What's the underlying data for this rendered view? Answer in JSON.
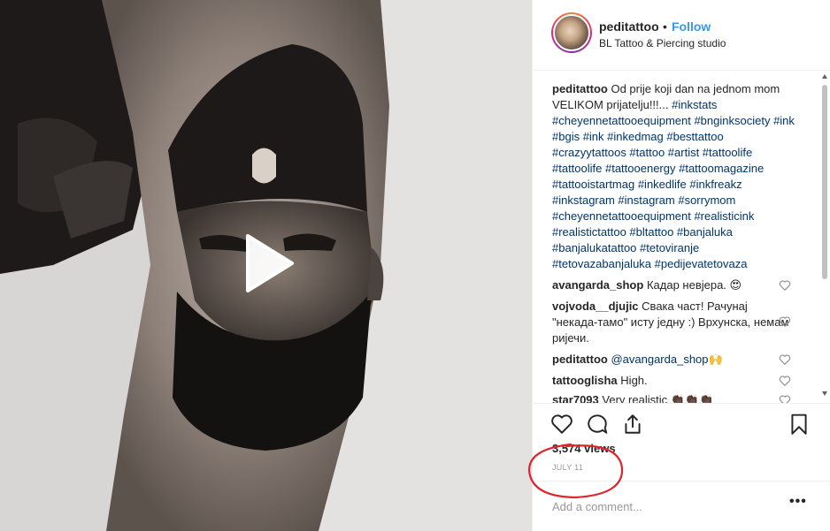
{
  "header": {
    "username": "peditattoo",
    "separator": "•",
    "follow_label": "Follow",
    "location": "BL Tattoo & Piercing studio"
  },
  "caption": {
    "username": "peditattoo",
    "text": "Od prije koji dan na jednom mom VELIKOM prijatelju!!!...",
    "hashtags": "#inkstats #cheyennetattooequipment #bnginksociety #ink #bgis #ink #inkedmag #besttattoo #crazyytattoos #tattoo #artist #tattoolife #tattoolife #tattooenergy #tattoomagazine #tattooistartmag #inkedlife #inkfreakz #inkstagram #instagram #sorrymom #cheyennetattooequipment #realisticink #realistictattoo #bltattoo #banjaluka #banjalukatattoo #tetoviranje #tetovazabanjaluka #pedijevatetovaza"
  },
  "comments": [
    {
      "username": "avangarda_shop",
      "text": "Кадар невјера. 😍"
    },
    {
      "username": "vojvoda__djujic",
      "text": "Свака част! Рачунај \"некада-тамо\" исту једну :) Врхунска, немам ријечи."
    },
    {
      "username": "peditattoo",
      "mention": "@avangarda_shop",
      "text": "🙌"
    },
    {
      "username": "tattooglisha",
      "text": "High."
    },
    {
      "username": "star7093",
      "text": "Very realistic 👏🏿👏🏿👏🏿"
    }
  ],
  "stats": {
    "views": "3,574 views",
    "date": "JULY 11"
  },
  "add_comment": {
    "placeholder": "Add a comment...",
    "more_label": "•••"
  },
  "icons": {
    "like": "heart-icon",
    "comment": "comment-icon",
    "share": "share-icon",
    "save": "bookmark-icon",
    "play": "play-icon"
  },
  "colors": {
    "link_blue": "#3897f0",
    "hashtag": "#003569",
    "annotation_red": "#e0242b"
  }
}
